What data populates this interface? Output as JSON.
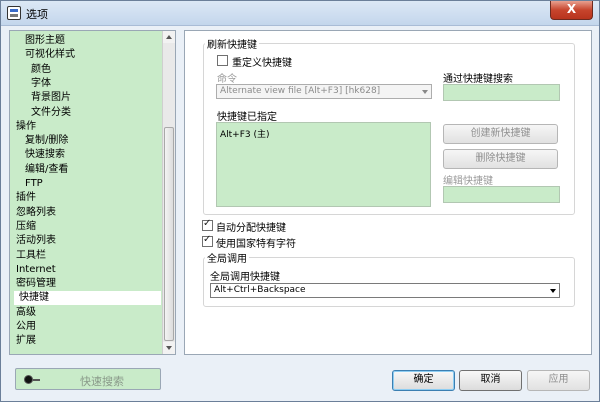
{
  "window": {
    "title": "选项",
    "close_label": "X"
  },
  "tree": {
    "items": [
      {
        "label": "图形主题",
        "level": 1
      },
      {
        "label": "可视化样式",
        "level": 1
      },
      {
        "label": "颜色",
        "level": 2
      },
      {
        "label": "字体",
        "level": 2
      },
      {
        "label": "背景图片",
        "level": 2
      },
      {
        "label": "文件分类",
        "level": 2
      },
      {
        "label": "操作",
        "level": 0
      },
      {
        "label": "复制/删除",
        "level": 1
      },
      {
        "label": "快速搜索",
        "level": 1
      },
      {
        "label": "编辑/查看",
        "level": 1
      },
      {
        "label": "FTP",
        "level": 1
      },
      {
        "label": "插件",
        "level": 0
      },
      {
        "label": "忽略列表",
        "level": 0
      },
      {
        "label": "压缩",
        "level": 0
      },
      {
        "label": "活动列表",
        "level": 0
      },
      {
        "label": "工具栏",
        "level": 0
      },
      {
        "label": "Internet",
        "level": 0
      },
      {
        "label": "密码管理",
        "level": 0
      },
      {
        "label": "快捷键",
        "level": 0,
        "selected": true
      },
      {
        "label": "高级",
        "level": 0
      },
      {
        "label": "公用",
        "level": 0
      },
      {
        "label": "扩展",
        "level": 0
      }
    ]
  },
  "refresh_group": {
    "title": "刷新快捷键",
    "redefine_label": "重定义快捷键",
    "command_label": "命令",
    "command_value": "Alternate view file [Alt+F3] [hk628]",
    "search_label": "通过快捷键搜索",
    "assigned_label": "快捷键已指定",
    "assigned_items": [
      "Alt+F3 (主)"
    ],
    "create_button": "创建新快捷键",
    "delete_button": "删除快捷键",
    "edit_label": "编辑快捷键"
  },
  "options": {
    "auto_assign_label": "自动分配快捷键",
    "country_chars_label": "使用国家特有字符"
  },
  "global_group": {
    "title": "全局调用",
    "hotkey_label": "全局调用快捷键",
    "hotkey_value": "Alt+Ctrl+Backspace"
  },
  "footer": {
    "quick_search": "快速搜索",
    "ok": "确定",
    "cancel": "取消",
    "apply": "应用"
  }
}
